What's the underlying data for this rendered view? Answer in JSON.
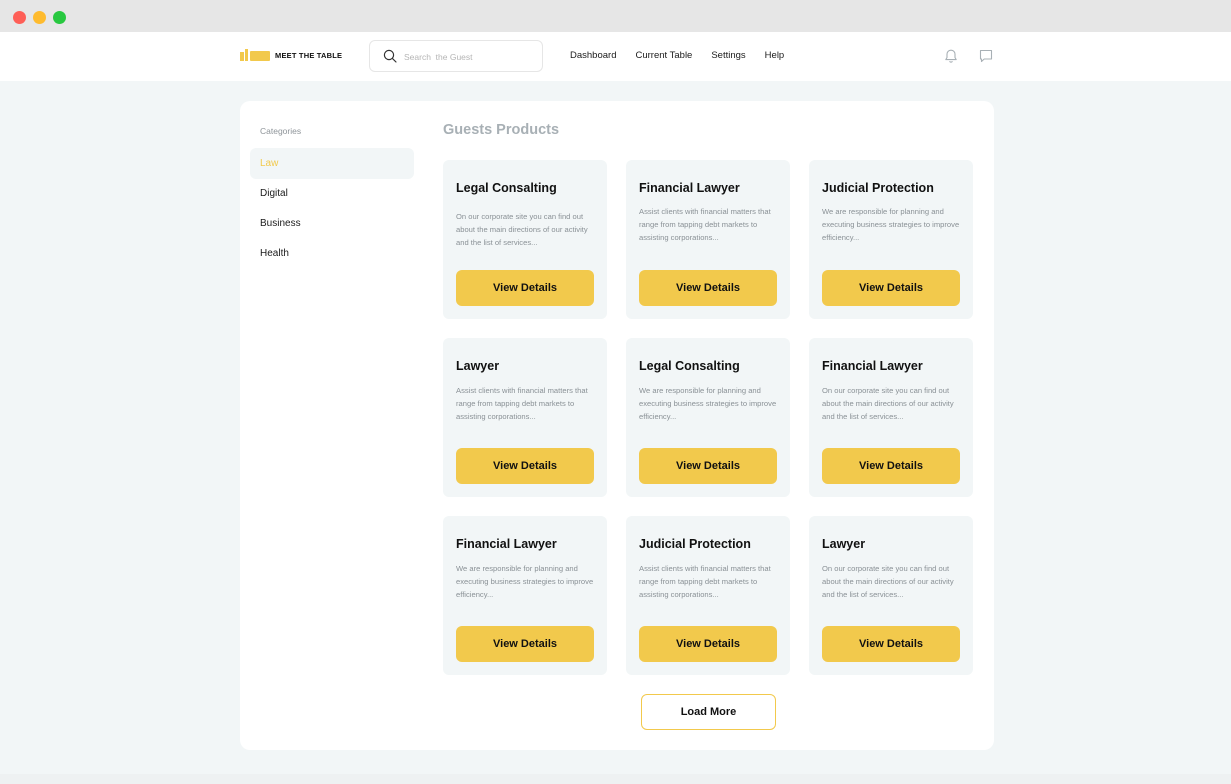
{
  "brand": {
    "name": "MEET THE TABLE",
    "accent": "#F2C94C"
  },
  "search": {
    "placeholder": "Search  the Guest",
    "value": ""
  },
  "nav": {
    "links": [
      "Dashboard",
      "Current Table",
      "Settings",
      "Help"
    ],
    "icons": [
      "bell-icon",
      "chat-icon"
    ]
  },
  "sidebar": {
    "title": "Categories",
    "items": [
      {
        "label": "Law",
        "active": true
      },
      {
        "label": "Digital",
        "active": false
      },
      {
        "label": "Business",
        "active": false
      },
      {
        "label": "Health",
        "active": false
      }
    ]
  },
  "main": {
    "heading": "Guests Products",
    "cards": [
      {
        "title": "Legal Consalting",
        "desc": "On our corporate site you can find out about the main directions of our activity and the list of services...",
        "button": "View Details"
      },
      {
        "title": "Financial Lawyer",
        "desc": "Assist clients with financial matters that range from tapping debt markets to assisting corporations...",
        "button": "View Details"
      },
      {
        "title": "Judicial Protection",
        "desc": "We are responsible for planning and executing business strategies to improve efficiency...",
        "button": "View Details"
      },
      {
        "title": "Lawyer",
        "desc": "Assist clients with financial matters that range from tapping debt markets to assisting corporations...",
        "button": "View Details"
      },
      {
        "title": "Legal Consalting",
        "desc": "We are responsible for planning and executing business strategies to improve efficiency...",
        "button": "View Details"
      },
      {
        "title": "Financial Lawyer",
        "desc": "On our corporate site you can find out about the main directions of our activity and the list of services...",
        "button": "View Details"
      },
      {
        "title": "Financial Lawyer",
        "desc": "We are responsible for planning and executing business strategies to improve efficiency...",
        "button": "View Details"
      },
      {
        "title": "Judicial Protection",
        "desc": "Assist clients with financial matters that range from tapping debt markets to assisting corporations...",
        "button": "View Details"
      },
      {
        "title": "Lawyer",
        "desc": "On our corporate site you can find out about the main directions of our activity and the list of services...",
        "button": "View Details"
      }
    ],
    "load_more": "Load More"
  }
}
